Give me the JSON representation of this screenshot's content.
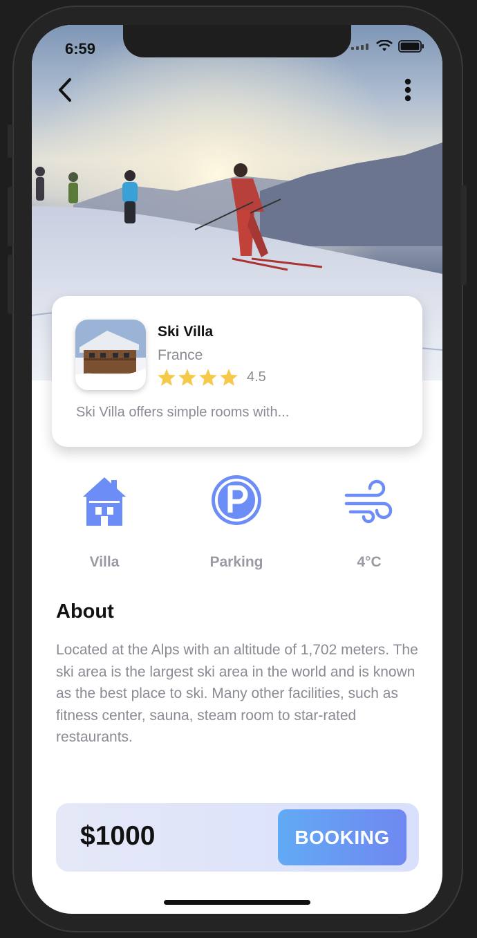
{
  "status_bar": {
    "time": "6:59"
  },
  "card": {
    "title": "Ski Villa",
    "location": "France",
    "rating": "4.5",
    "stars": 4,
    "description": "Ski Villa offers simple rooms with..."
  },
  "features": [
    {
      "label": "Villa",
      "icon": "house-icon"
    },
    {
      "label": "Parking",
      "icon": "parking-icon"
    },
    {
      "label": "4°C",
      "icon": "wind-icon"
    }
  ],
  "about": {
    "title": "About",
    "text": "Located at the Alps with an altitude of 1,702 meters. The ski area is the largest ski area in the world and is known as the best place to ski. Many other facilities, such as fitness center, sauna, steam room to star-rated restaurants."
  },
  "booking": {
    "price": "$1000",
    "button_label": "BOOKING"
  },
  "colors": {
    "accent": "#6f88f0",
    "icon_blue": "#6b8df5",
    "star": "#f6c94a"
  }
}
